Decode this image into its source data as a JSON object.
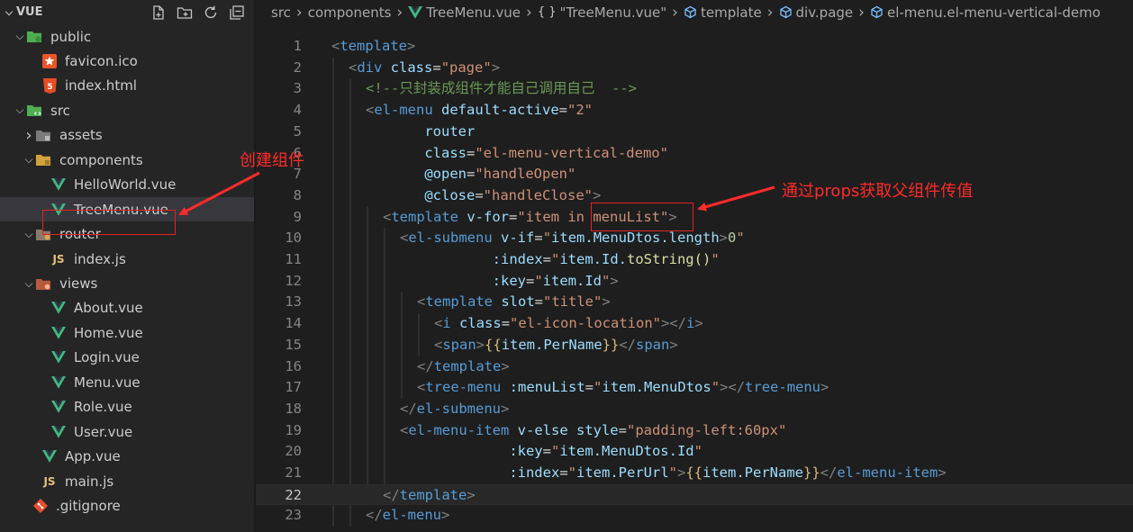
{
  "explorer": {
    "title": "VUE",
    "items": [
      {
        "label": "public",
        "icon": "folder-public-icon",
        "twisty": "open",
        "indent": 0
      },
      {
        "label": "favicon.ico",
        "icon": "favicon-star-icon",
        "twisty": "",
        "indent": 1
      },
      {
        "label": "index.html",
        "icon": "html5-icon",
        "twisty": "",
        "indent": 1
      },
      {
        "label": "src",
        "icon": "folder-src-icon",
        "twisty": "open",
        "indent": 0
      },
      {
        "label": "assets",
        "icon": "folder-assets-icon",
        "twisty": "closed",
        "indent": 1
      },
      {
        "label": "components",
        "icon": "folder-components-icon",
        "twisty": "open",
        "indent": 1
      },
      {
        "label": "HelloWorld.vue",
        "icon": "vue-icon",
        "twisty": "",
        "indent": 2
      },
      {
        "label": "TreeMenu.vue",
        "icon": "vue-icon",
        "twisty": "",
        "indent": 2,
        "active": true
      },
      {
        "label": "router",
        "icon": "folder-router-icon",
        "twisty": "open",
        "indent": 1
      },
      {
        "label": "index.js",
        "icon": "js-icon",
        "twisty": "",
        "indent": 2
      },
      {
        "label": "views",
        "icon": "folder-views-icon",
        "twisty": "open",
        "indent": 1
      },
      {
        "label": "About.vue",
        "icon": "vue-icon",
        "twisty": "",
        "indent": 2
      },
      {
        "label": "Home.vue",
        "icon": "vue-icon",
        "twisty": "",
        "indent": 2
      },
      {
        "label": "Login.vue",
        "icon": "vue-icon",
        "twisty": "",
        "indent": 2
      },
      {
        "label": "Menu.vue",
        "icon": "vue-icon",
        "twisty": "",
        "indent": 2
      },
      {
        "label": "Role.vue",
        "icon": "vue-icon",
        "twisty": "",
        "indent": 2
      },
      {
        "label": "User.vue",
        "icon": "vue-icon",
        "twisty": "",
        "indent": 2
      },
      {
        "label": "App.vue",
        "icon": "vue-icon",
        "twisty": "",
        "indent": 1
      },
      {
        "label": "main.js",
        "icon": "js-icon",
        "twisty": "",
        "indent": 1
      },
      {
        "label": ".gitignore",
        "icon": "git-icon",
        "twisty": "",
        "indent": 0
      }
    ]
  },
  "breadcrumb": {
    "items": [
      {
        "label": "src",
        "icon": ""
      },
      {
        "label": "components",
        "icon": ""
      },
      {
        "label": "TreeMenu.vue",
        "icon": "vue-icon"
      },
      {
        "label": "\"TreeMenu.vue\"",
        "icon": "braces-icon"
      },
      {
        "label": "template",
        "icon": "cube-icon"
      },
      {
        "label": "div.page",
        "icon": "cube-icon"
      },
      {
        "label": "el-menu.el-menu-vertical-demo",
        "icon": "cube-icon"
      }
    ]
  },
  "editor": {
    "current_line": 22,
    "lines": [
      {
        "n": "1",
        "indent": 0,
        "tokens": [
          [
            "<",
            "b"
          ],
          [
            "template",
            "t"
          ],
          [
            ">",
            "b"
          ]
        ]
      },
      {
        "n": "2",
        "indent": 1,
        "tokens": [
          [
            "<",
            "b"
          ],
          [
            "div",
            "t"
          ],
          [
            " class",
            "a"
          ],
          [
            "=",
            "p"
          ],
          [
            "\"page\"",
            "s"
          ],
          [
            ">",
            "b"
          ]
        ]
      },
      {
        "n": "3",
        "indent": 2,
        "tokens": [
          [
            "<!--只封装成组件才能自己调用自己  -->",
            "c"
          ]
        ]
      },
      {
        "n": "4",
        "indent": 2,
        "tokens": [
          [
            "<",
            "b"
          ],
          [
            "el-menu",
            "t"
          ],
          [
            " default-active",
            "a"
          ],
          [
            "=",
            "p"
          ],
          [
            "\"2\"",
            "s"
          ]
        ]
      },
      {
        "n": "5",
        "indent": 2,
        "tokens": [
          [
            "       router",
            "a"
          ]
        ]
      },
      {
        "n": "6",
        "indent": 2,
        "tokens": [
          [
            "       class",
            "a"
          ],
          [
            "=",
            "p"
          ],
          [
            "\"el-menu-vertical-demo\"",
            "s"
          ]
        ]
      },
      {
        "n": "7",
        "indent": 2,
        "tokens": [
          [
            "       @open",
            "a"
          ],
          [
            "=",
            "p"
          ],
          [
            "\"handleOpen\"",
            "s"
          ]
        ]
      },
      {
        "n": "8",
        "indent": 2,
        "tokens": [
          [
            "       @close",
            "a"
          ],
          [
            "=",
            "p"
          ],
          [
            "\"handleClose\"",
            "s"
          ],
          [
            ">",
            "b"
          ]
        ]
      },
      {
        "n": "9",
        "indent": 3,
        "tokens": [
          [
            "<",
            "b"
          ],
          [
            "template",
            "t"
          ],
          [
            " v-for",
            "a"
          ],
          [
            "=",
            "p"
          ],
          [
            "\"item in menuList\"",
            "s"
          ],
          [
            ">",
            "b"
          ]
        ]
      },
      {
        "n": "10",
        "indent": 4,
        "tokens": [
          [
            "<",
            "b"
          ],
          [
            "el-submenu",
            "t"
          ],
          [
            " v-if",
            "a"
          ],
          [
            "=",
            "p"
          ],
          [
            "\"",
            "s"
          ],
          [
            "item.MenuDtos.length",
            "x"
          ],
          [
            ">",
            "b"
          ],
          [
            "0",
            "n"
          ],
          [
            "\"",
            "s"
          ]
        ]
      },
      {
        "n": "11",
        "indent": 4,
        "tokens": [
          [
            "           :index",
            "a"
          ],
          [
            "=",
            "p"
          ],
          [
            "\"",
            "s"
          ],
          [
            "item.Id.",
            "x"
          ],
          [
            "toString()",
            "f"
          ],
          [
            "\"",
            "s"
          ]
        ]
      },
      {
        "n": "12",
        "indent": 4,
        "tokens": [
          [
            "           :key",
            "a"
          ],
          [
            "=",
            "p"
          ],
          [
            "\"",
            "s"
          ],
          [
            "item.Id",
            "x"
          ],
          [
            "\"",
            "s"
          ],
          [
            ">",
            "b"
          ]
        ]
      },
      {
        "n": "13",
        "indent": 5,
        "tokens": [
          [
            "<",
            "b"
          ],
          [
            "template",
            "t"
          ],
          [
            " slot",
            "a"
          ],
          [
            "=",
            "p"
          ],
          [
            "\"title\"",
            "s"
          ],
          [
            ">",
            "b"
          ]
        ]
      },
      {
        "n": "14",
        "indent": 6,
        "tokens": [
          [
            "<",
            "b"
          ],
          [
            "i",
            "t"
          ],
          [
            " class",
            "a"
          ],
          [
            "=",
            "p"
          ],
          [
            "\"el-icon-location\"",
            "s"
          ],
          [
            "></",
            "b"
          ],
          [
            "i",
            "t"
          ],
          [
            ">",
            "b"
          ]
        ]
      },
      {
        "n": "15",
        "indent": 6,
        "tokens": [
          [
            "<",
            "b"
          ],
          [
            "span",
            "t"
          ],
          [
            ">",
            "b"
          ],
          [
            "{{",
            "y"
          ],
          [
            "item.PerName",
            "x"
          ],
          [
            "}}",
            "y"
          ],
          [
            "</",
            "b"
          ],
          [
            "span",
            "t"
          ],
          [
            ">",
            "b"
          ]
        ]
      },
      {
        "n": "16",
        "indent": 5,
        "tokens": [
          [
            "</",
            "b"
          ],
          [
            "template",
            "t"
          ],
          [
            ">",
            "b"
          ]
        ]
      },
      {
        "n": "17",
        "indent": 5,
        "tokens": [
          [
            "<",
            "b"
          ],
          [
            "tree-menu",
            "t"
          ],
          [
            " :menuList",
            "a"
          ],
          [
            "=",
            "p"
          ],
          [
            "\"",
            "s"
          ],
          [
            "item.MenuDtos",
            "x"
          ],
          [
            "\"",
            "s"
          ],
          [
            "></",
            "b"
          ],
          [
            "tree-menu",
            "t"
          ],
          [
            ">",
            "b"
          ]
        ]
      },
      {
        "n": "18",
        "indent": 4,
        "tokens": [
          [
            "</",
            "b"
          ],
          [
            "el-submenu",
            "t"
          ],
          [
            ">",
            "b"
          ]
        ]
      },
      {
        "n": "19",
        "indent": 4,
        "tokens": [
          [
            "<",
            "b"
          ],
          [
            "el-menu-item",
            "t"
          ],
          [
            " v-else style",
            "a"
          ],
          [
            "=",
            "p"
          ],
          [
            "\"padding-left:60px\"",
            "s"
          ]
        ]
      },
      {
        "n": "20",
        "indent": 4,
        "tokens": [
          [
            "             :key",
            "a"
          ],
          [
            "=",
            "p"
          ],
          [
            "\"",
            "s"
          ],
          [
            "item.MenuDtos.Id",
            "x"
          ],
          [
            "\"",
            "s"
          ]
        ]
      },
      {
        "n": "21",
        "indent": 4,
        "tokens": [
          [
            "             :index",
            "a"
          ],
          [
            "=",
            "p"
          ],
          [
            "\"",
            "s"
          ],
          [
            "item.PerUrl",
            "x"
          ],
          [
            "\"",
            "s"
          ],
          [
            ">",
            "b"
          ],
          [
            "{{",
            "y"
          ],
          [
            "item.PerName",
            "x"
          ],
          [
            "}}",
            "y"
          ],
          [
            "</",
            "b"
          ],
          [
            "el-menu-item",
            "t"
          ],
          [
            ">",
            "b"
          ]
        ]
      },
      {
        "n": "22",
        "indent": 3,
        "tokens": [
          [
            "</",
            "b"
          ],
          [
            "template",
            "t"
          ],
          [
            ">",
            "b"
          ]
        ]
      },
      {
        "n": "23",
        "indent": 2,
        "tokens": [
          [
            "</",
            "b"
          ],
          [
            "el-menu",
            "t"
          ],
          [
            ">",
            "b"
          ]
        ]
      }
    ]
  },
  "annotations": {
    "create_component": "创建组件",
    "props_note": "通过props获取父组件传值"
  },
  "colors": {
    "tag": "#569cd6",
    "bracket": "#808080",
    "attr": "#9cdcfe",
    "string": "#ce9178",
    "comment": "#6a9955",
    "expr": "#9cdcfe",
    "func": "#dcdcaa",
    "number": "#b5cea8",
    "mustache": "#d7ba7d",
    "annot": "#ff2a2a",
    "vue": "#41b883",
    "js": "#e5c07b"
  }
}
